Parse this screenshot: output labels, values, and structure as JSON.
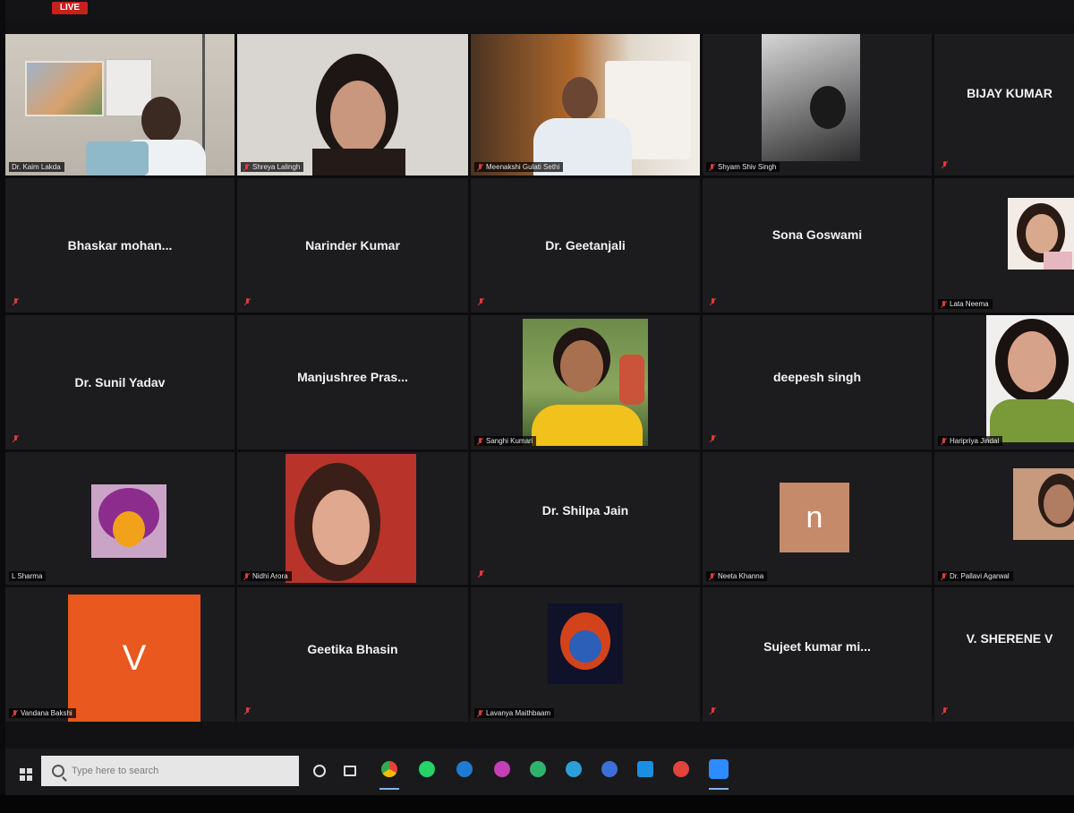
{
  "app": {
    "recording_badge": "LIVE"
  },
  "participants": [
    {
      "id": "p1",
      "label": "Dr. Kaim Lakda",
      "display": "video",
      "active": true
    },
    {
      "id": "p2",
      "label": "Shreya Lalingh",
      "display": "video"
    },
    {
      "id": "p3",
      "label": "Meenakshi Gulati Sethi",
      "display": "video"
    },
    {
      "id": "p4",
      "label": "Shyam Shiv Singh",
      "display": "video"
    },
    {
      "id": "p5",
      "name": "BIJAY KUMAR",
      "display": "name"
    },
    {
      "id": "p6",
      "name": "Bhaskar mohan...",
      "display": "name"
    },
    {
      "id": "p7",
      "name": "Narinder Kumar",
      "display": "name"
    },
    {
      "id": "p8",
      "name": "Dr. Geetanjali",
      "display": "name"
    },
    {
      "id": "p9",
      "name": "Sona Goswami",
      "display": "name"
    },
    {
      "id": "p10",
      "label": "Lata Neema",
      "display": "photo"
    },
    {
      "id": "p11",
      "name": "Dr. Sunil Yadav",
      "display": "name"
    },
    {
      "id": "p12",
      "name": "Manjushree Pras...",
      "display": "name"
    },
    {
      "id": "p13",
      "label": "Sanghi Kumari",
      "display": "photo"
    },
    {
      "id": "p14",
      "name": "deepesh singh",
      "display": "name"
    },
    {
      "id": "p15",
      "label": "Haripriya Jindal",
      "display": "photo"
    },
    {
      "id": "p16",
      "label": "L Sharma",
      "display": "photo"
    },
    {
      "id": "p17",
      "label": "Nidhi Arora",
      "display": "photo"
    },
    {
      "id": "p18",
      "name": "Dr. Shilpa Jain",
      "display": "name"
    },
    {
      "id": "p19",
      "label": "Neeta Khanna",
      "display": "avatar",
      "avatar_letter": "n",
      "avatar_color": "#c48a6a"
    },
    {
      "id": "p20",
      "label": "Dr. Pallavi Agarwal",
      "display": "photo"
    },
    {
      "id": "p21",
      "label": "Vandana Bakshi",
      "display": "avatar",
      "avatar_letter": "V",
      "avatar_color": "#e9581f"
    },
    {
      "id": "p22",
      "name": "Geetika Bhasin",
      "display": "name"
    },
    {
      "id": "p23",
      "label": "Lavanya Maithbaam",
      "display": "photo"
    },
    {
      "id": "p24",
      "name": "Sujeet kumar mi...",
      "display": "name"
    },
    {
      "id": "p25",
      "name": "V. SHERENE V",
      "display": "name"
    }
  ],
  "taskbar": {
    "search_placeholder": "Type here to search",
    "pinned_icons": [
      "cortana-icon",
      "task-view-icon",
      "chrome-icon",
      "whatsapp-icon",
      "edge-legacy-icon",
      "app-purple-icon",
      "app-green-icon",
      "edge-icon",
      "app-blue-icon",
      "mail-icon",
      "app-red-icon",
      "zoom-icon"
    ]
  },
  "colors": {
    "active_speaker": "#d8cf3a",
    "tile_bg": "#1c1c1e",
    "mic_muted": "#e03a3a"
  }
}
